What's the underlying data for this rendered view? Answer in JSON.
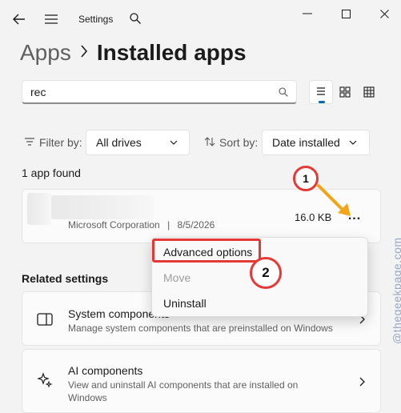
{
  "window": {
    "title": "Settings"
  },
  "breadcrumb": {
    "parent": "Apps",
    "separator": ">",
    "current": "Installed apps"
  },
  "search": {
    "value": "rec"
  },
  "view_modes": [
    "list-view",
    "tile-view",
    "grid-view"
  ],
  "filter": {
    "label": "Filter by:",
    "value": "All drives"
  },
  "sort": {
    "label": "Sort by:",
    "value": "Date installed"
  },
  "results": {
    "count_text": "1 app found"
  },
  "app": {
    "publisher": "Microsoft Corporation",
    "separator": "|",
    "date": "8/5/2026",
    "size": "16.0 KB",
    "more_label": "..."
  },
  "context_menu": {
    "items": [
      {
        "label": "Advanced options",
        "enabled": true
      },
      {
        "label": "Move",
        "enabled": false
      },
      {
        "label": "Uninstall",
        "enabled": true
      }
    ]
  },
  "related": {
    "heading": "Related settings",
    "cards": [
      {
        "title": "System components",
        "description": "Manage system components that are preinstalled on Windows"
      },
      {
        "title": "AI components",
        "description": "View and uninstall AI components that are installed on Windows"
      }
    ]
  },
  "annotations": {
    "step1": "1",
    "step2": "2",
    "highlight_color": "#e53935",
    "arrow_color": "#f2a518"
  },
  "watermark": "@thegeekpage.com"
}
